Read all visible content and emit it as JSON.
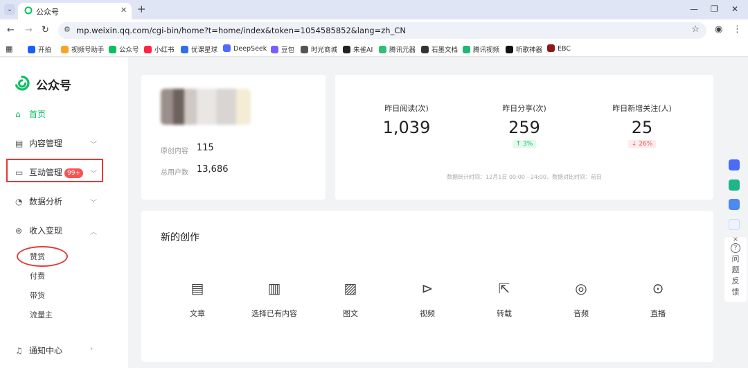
{
  "browser": {
    "tab_title": "公众号",
    "tab_close": "✕",
    "new_tab": "+",
    "url": "mp.weixin.qq.com/cgi-bin/home?t=home/index&token=1054585852&lang=zh_CN",
    "window_min": "—",
    "window_max": "❐",
    "window_close": "✕",
    "bookmarks": [
      {
        "label": "开拍",
        "color": "#1a5cff"
      },
      {
        "label": "视频号助手",
        "color": "#f6a623"
      },
      {
        "label": "公众号",
        "color": "#07c160"
      },
      {
        "label": "小红书",
        "color": "#ff2442"
      },
      {
        "label": "优课星球",
        "color": "#2f6fed"
      },
      {
        "label": "DeepSeek",
        "color": "#4d6bfe"
      },
      {
        "label": "豆包",
        "color": "#7a5cff"
      },
      {
        "label": "时光商城",
        "color": "#555555"
      },
      {
        "label": "朱雀AI",
        "color": "#222222"
      },
      {
        "label": "腾讯元器",
        "color": "#2fbf71"
      },
      {
        "label": "石墨文档",
        "color": "#333333"
      },
      {
        "label": "腾讯视频",
        "color": "#22b573"
      },
      {
        "label": "听歌神器",
        "color": "#111111"
      },
      {
        "label": "EBC",
        "color": "#8b1a1a"
      }
    ]
  },
  "sidebar": {
    "brand": "公众号",
    "items": [
      {
        "label": "首页"
      },
      {
        "label": "内容管理"
      },
      {
        "label": "互动管理",
        "badge": "99+"
      },
      {
        "label": "数据分析"
      },
      {
        "label": "收入变现"
      }
    ],
    "sub_items": [
      "赞赏",
      "付费",
      "带货",
      "流量主"
    ],
    "notify": "通知中心"
  },
  "account": {
    "original_label": "原创内容",
    "original_value": "115",
    "users_label": "总用户数",
    "users_value": "13,686"
  },
  "stats": {
    "items": [
      {
        "label": "昨日阅读(次)",
        "value": "1,039"
      },
      {
        "label": "昨日分享(次)",
        "value": "259",
        "change": "↑ 3%"
      },
      {
        "label": "昨日新增关注(人)",
        "value": "25",
        "change": "↓ 26%"
      }
    ],
    "note": "数据统计时间：12月1日 00:00 - 24:00，数据对比时间：前日"
  },
  "creation": {
    "title": "新的创作",
    "items": [
      "文章",
      "选择已有内容",
      "图文",
      "视频",
      "转载",
      "音频",
      "直播"
    ]
  },
  "feedback": {
    "close": "×",
    "chars": [
      "问",
      "题",
      "反",
      "馈"
    ]
  },
  "colors": {
    "accent": "#07c160",
    "annotation": "#e53935",
    "badge": "#fa5151"
  }
}
